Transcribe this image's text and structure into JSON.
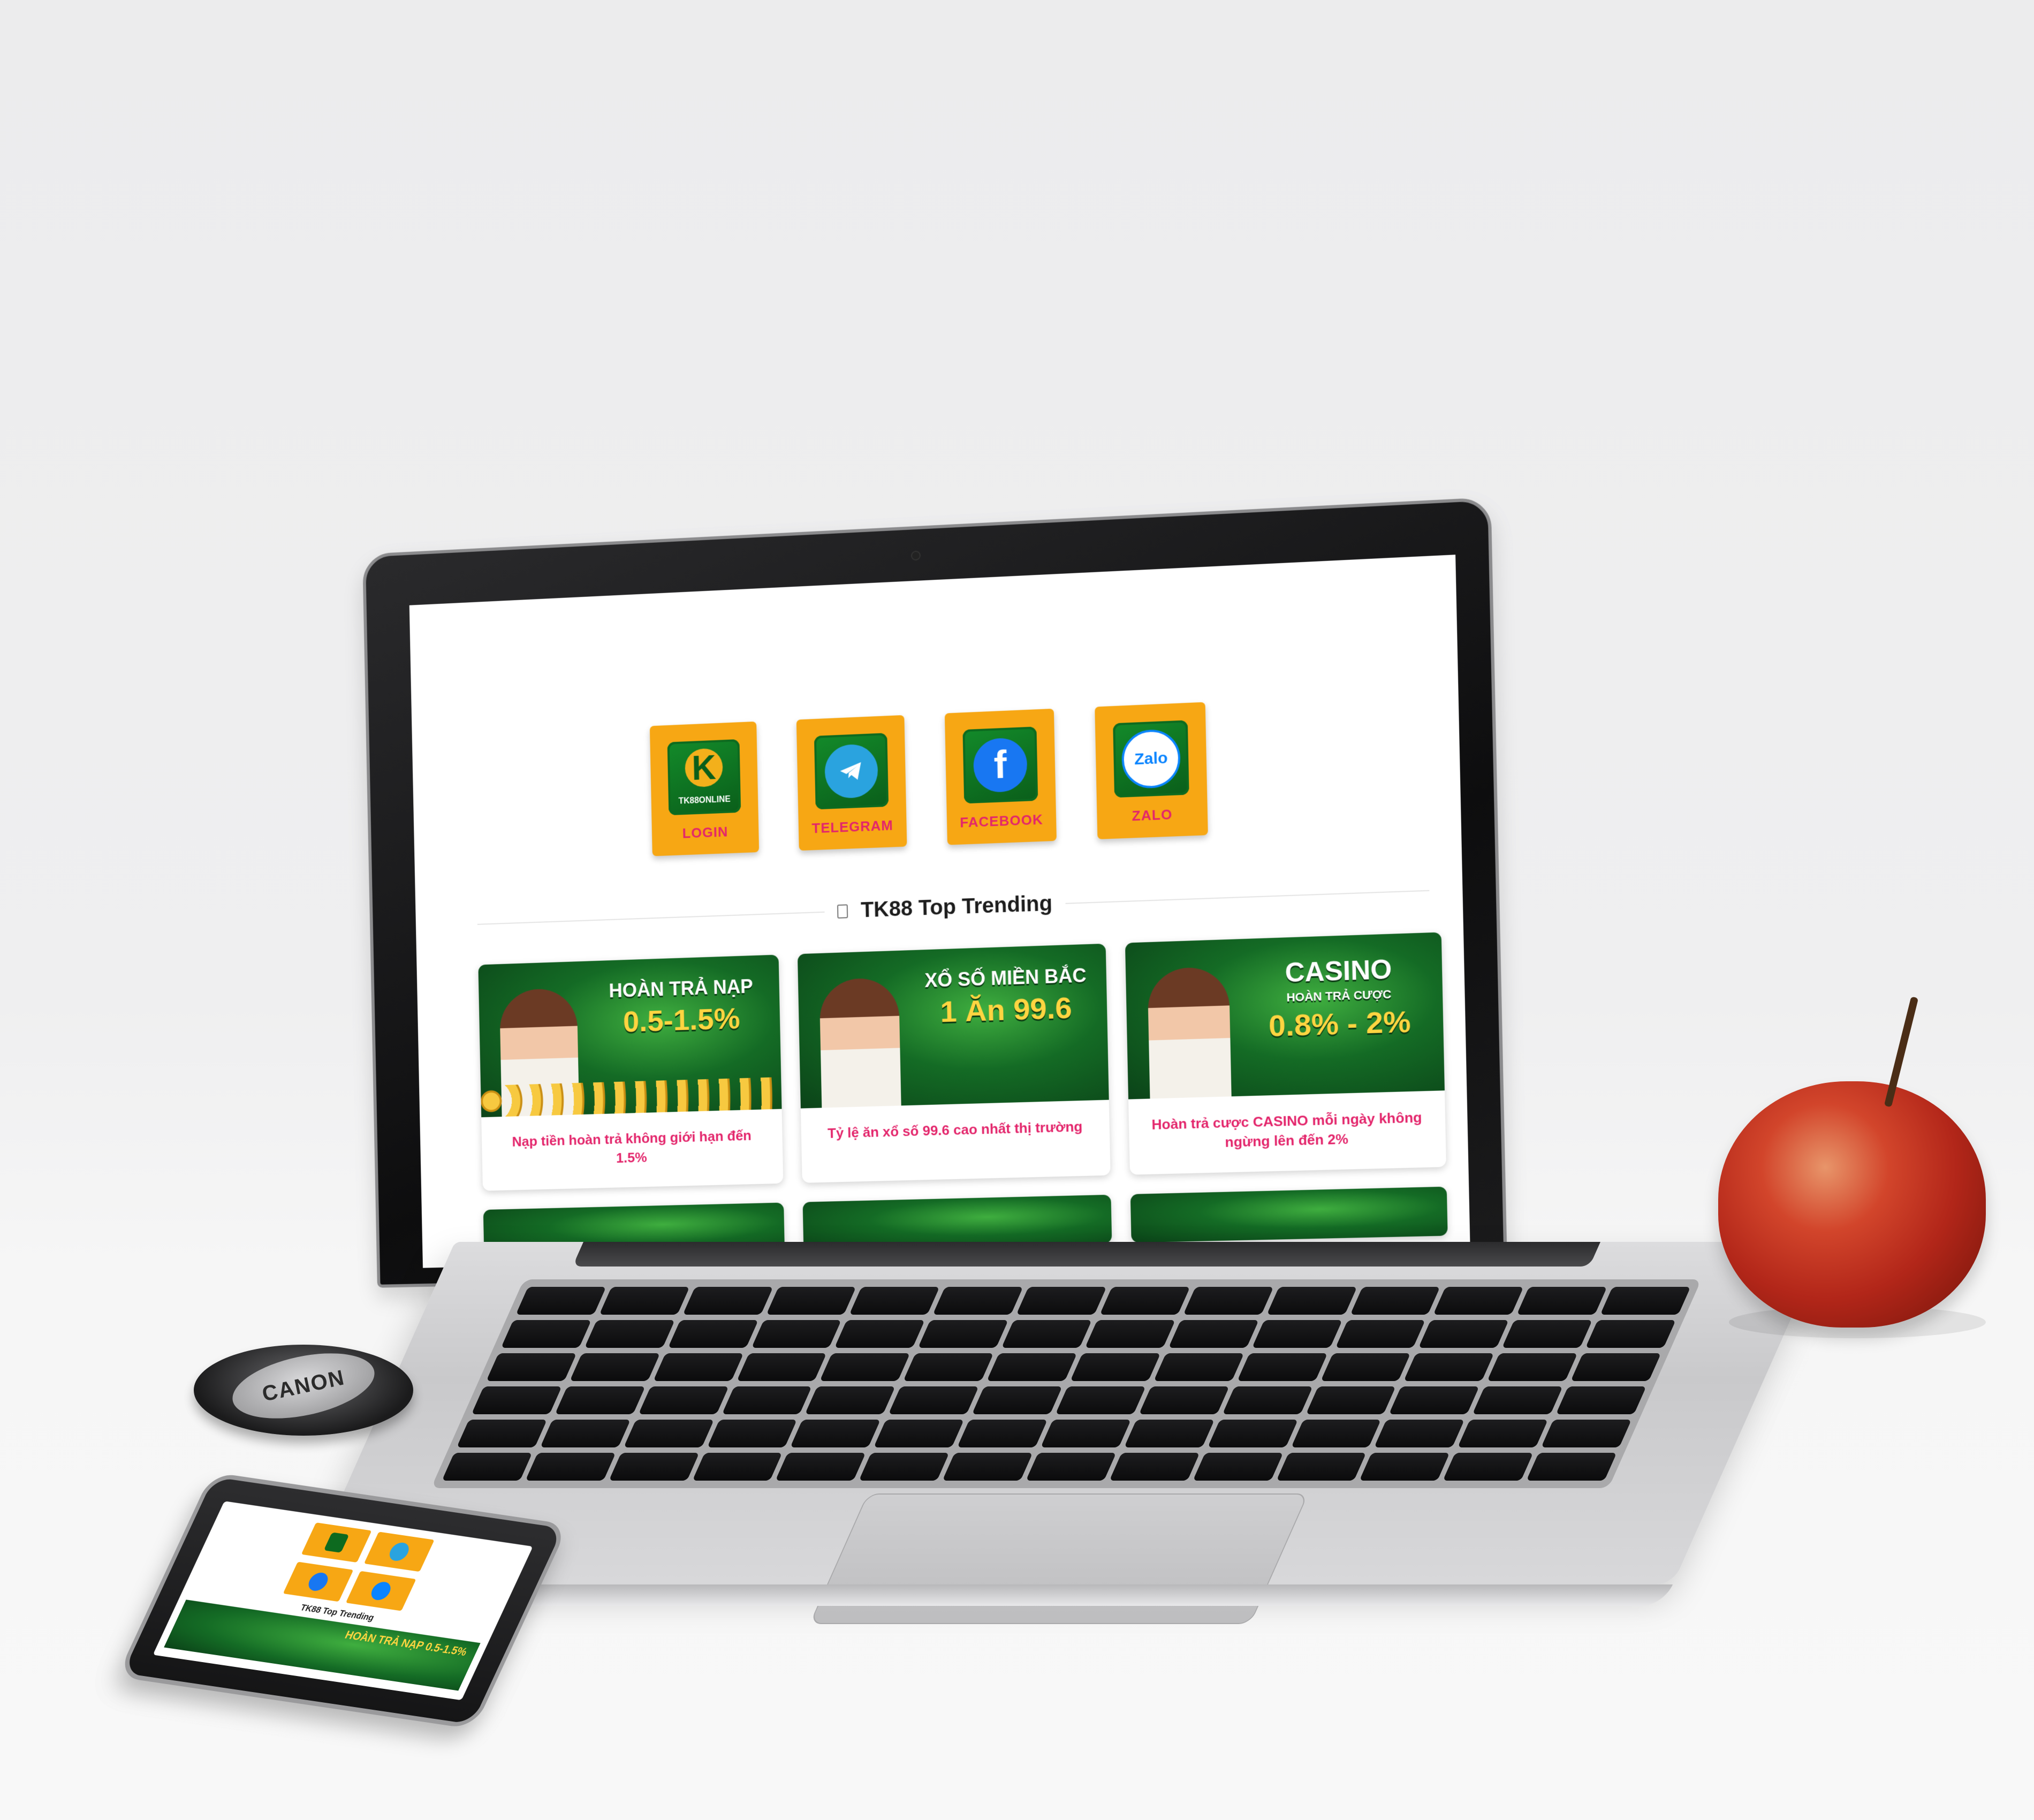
{
  "site": {
    "quick_links": [
      {
        "label": "LOGIN",
        "icon": "tk88-logo-icon",
        "icon_text": "TK88ONLINE"
      },
      {
        "label": "TELEGRAM",
        "icon": "telegram-icon"
      },
      {
        "label": "FACEBOOK",
        "icon": "facebook-icon"
      },
      {
        "label": "ZALO",
        "icon": "zalo-icon",
        "icon_text": "Zalo"
      }
    ],
    "section_title": "TK88 Top Trending",
    "cards": [
      {
        "banner_title": "HOÀN TRẢ NẠP",
        "banner_value": "0.5-1.5%",
        "caption": "Nạp tiền hoàn trả không giới hạn đến 1.5%"
      },
      {
        "banner_title": "XỔ SỐ MIỀN BẮC",
        "banner_value": "1 Ăn 99.6",
        "caption": "Tỷ lệ ăn xổ số 99.6 cao nhất thị trường"
      },
      {
        "banner_title": "CASINO",
        "banner_subtitle": "HOÀN TRẢ CƯỢC",
        "banner_value": "0.8% - 2%",
        "caption": "Hoàn trả cược CASINO mỗi ngày không ngừng lên đến 2%"
      }
    ]
  },
  "phone": {
    "section_title": "TK88 Top Trending",
    "banner_text": "HOÀN TRẢ NẠP 0.5-1.5%"
  },
  "lens_cap": {
    "brand": "CANON"
  },
  "colors": {
    "tile_orange": "#f7a714",
    "label_pink": "#e3256b",
    "banner_green": "#146b25",
    "telegram_blue": "#2aa3df",
    "facebook_blue": "#1877f2",
    "zalo_blue": "#0a84ff"
  }
}
